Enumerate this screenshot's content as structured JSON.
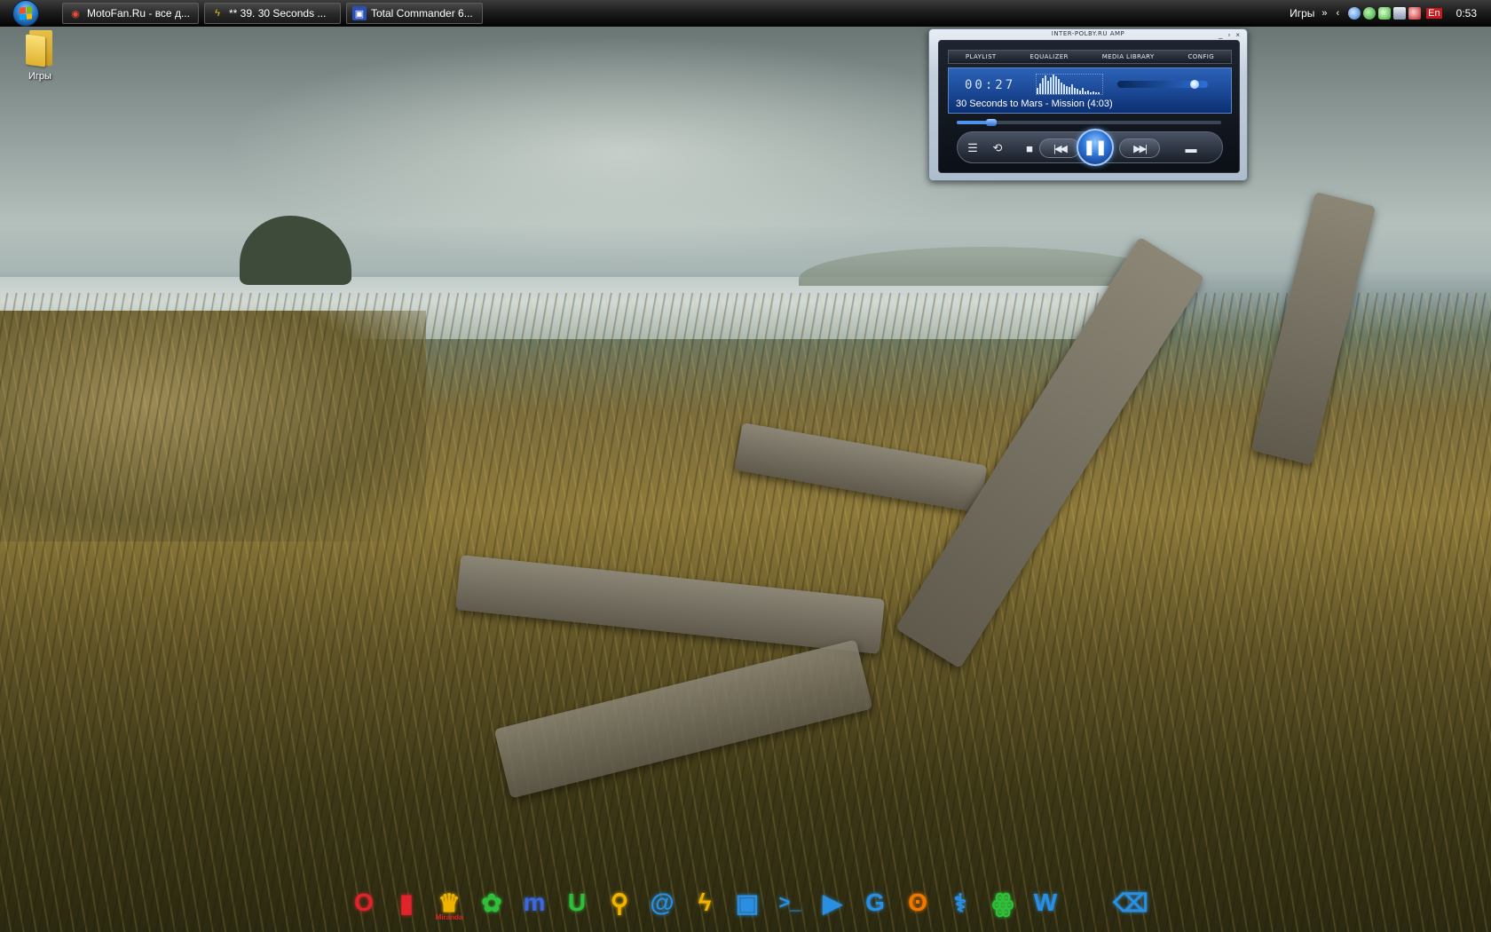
{
  "taskbar": {
    "tasks": [
      {
        "label": "MotoFan.Ru - все д...",
        "icon": "browser-icon",
        "icon_color": "#c0392b"
      },
      {
        "label": "** 39. 30 Seconds ...",
        "icon": "lightning-icon",
        "icon_color": "#f1c40f"
      },
      {
        "label": "Total Commander 6...",
        "icon": "floppy-icon",
        "icon_color": "#2c4fb5"
      }
    ],
    "tray": {
      "toolbar_label": "Игры",
      "chevron": "»",
      "expand": "‹",
      "icons": [
        "globe-icon",
        "network-icon",
        "chat-icon",
        "shield-icon",
        "volume-icon"
      ],
      "language": "En",
      "clock": "0:53"
    }
  },
  "desktop": {
    "icons": [
      {
        "label": "Игры",
        "icon": "folder-icon"
      }
    ]
  },
  "player": {
    "title": "INTER-POLBY.RU AMP",
    "window_buttons": [
      "_",
      "▫",
      "×"
    ],
    "menu": [
      "PLAYLIST",
      "EQUALIZER",
      "MEDIA LIBRARY",
      "CONFIG"
    ],
    "time": "00:27",
    "track": "30 Seconds to Mars - Mission (4:03)",
    "progress": 0.13,
    "volume": 0.85,
    "spectrum": [
      0.3,
      0.55,
      0.8,
      0.95,
      0.7,
      0.85,
      1.0,
      0.9,
      0.75,
      0.6,
      0.5,
      0.4,
      0.35,
      0.5,
      0.3,
      0.25,
      0.2,
      0.3,
      0.15,
      0.2,
      0.1,
      0.15,
      0.1,
      0.08
    ],
    "buttons": {
      "playlist": "☰",
      "repeat": "⟲",
      "stop": "■",
      "prev": "|◀◀",
      "pause": "❚❚",
      "next": "▶▶|",
      "open": "▬"
    }
  },
  "dock": {
    "items": [
      {
        "name": "opera-icon",
        "glyph": "O",
        "color": "#e0242b"
      },
      {
        "name": "rocket-icon",
        "glyph": "▮",
        "color": "#e0242b"
      },
      {
        "name": "miranda-icon",
        "glyph": "♛",
        "sub": "Miranda",
        "color": "#f0b400"
      },
      {
        "name": "icq-flower-icon",
        "glyph": "✿",
        "color": "#2fbf3a"
      },
      {
        "name": "mirc-icon",
        "glyph": "m",
        "color": "#3b67e0"
      },
      {
        "name": "utorrent-icon",
        "glyph": "U",
        "color": "#2fbf3a"
      },
      {
        "name": "aim-icon",
        "glyph": "⚲",
        "color": "#f0b400"
      },
      {
        "name": "mail-icon",
        "glyph": "@",
        "color": "#2a8fe0"
      },
      {
        "name": "lightning-icon",
        "glyph": "ϟ",
        "color": "#f0b400"
      },
      {
        "name": "floppy-icon",
        "glyph": "▣",
        "color": "#2a8fe0"
      },
      {
        "name": "terminal-icon",
        "glyph": ">_",
        "color": "#2a8fe0"
      },
      {
        "name": "play-icon",
        "glyph": "▶",
        "color": "#2a8fe0"
      },
      {
        "name": "skype-icon",
        "glyph": "G",
        "color": "#2a8fe0"
      },
      {
        "name": "fire-icon",
        "glyph": "ʘ",
        "color": "#f07800"
      },
      {
        "name": "microscope-icon",
        "glyph": "⚕",
        "color": "#2a8fe0"
      },
      {
        "name": "game-icon",
        "glyph": "ꙮ",
        "color": "#2fbf3a"
      },
      {
        "name": "word-icon",
        "glyph": "W",
        "color": "#2a8fe0"
      },
      {
        "name": "apple-icon",
        "glyph": "",
        "color": "#2a8fe0"
      },
      {
        "name": "trash-icon",
        "glyph": "⌫",
        "color": "#2a8fe0"
      }
    ]
  },
  "colors": {
    "accent": "#2e74d8",
    "taskbar": "#1b1b1b",
    "language_badge": "#c8171d"
  }
}
